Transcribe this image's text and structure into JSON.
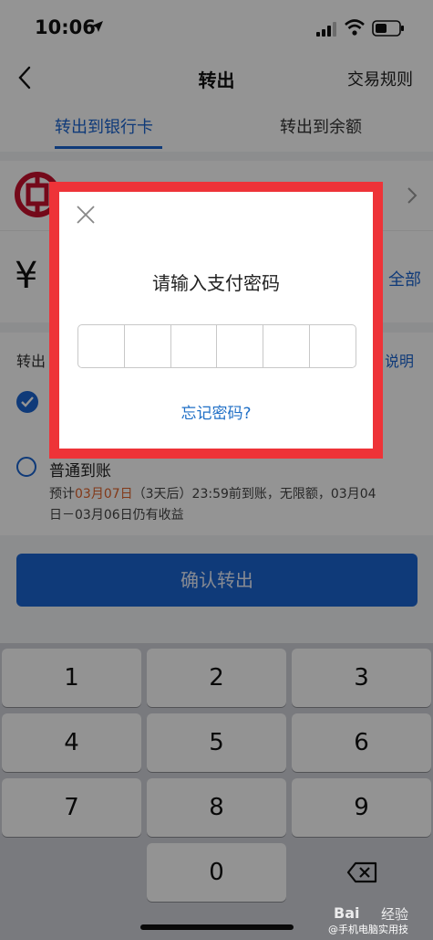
{
  "status_bar": {
    "time": "10:06"
  },
  "nav": {
    "title": "转出",
    "rules_label": "交易规则"
  },
  "tabs": [
    {
      "label": "转出到银行卡",
      "active": true
    },
    {
      "label": "转出到余额",
      "active": false
    }
  ],
  "amount": {
    "currency_symbol": "¥",
    "all_label": "全部"
  },
  "method": {
    "label_partial": "转出",
    "desc_link_partial": "说明",
    "option1": {
      "label_partial": "",
      "sub_partial": ""
    },
    "option2": {
      "label": "普通到账",
      "line1_prefix": "预计",
      "line1_date": "03月07日",
      "line1_suffix": "（3天后）23:59前到账，无限额，03月04",
      "line2": "日－03月06日仍有收益"
    }
  },
  "confirm_label": "确认转出",
  "keypad": {
    "keys": [
      "1",
      "2",
      "3",
      "4",
      "5",
      "6",
      "7",
      "8",
      "9",
      "",
      "0",
      "⌫"
    ]
  },
  "dialog": {
    "title": "请输入支付密码",
    "pin_length": 6,
    "forgot_label": "忘记密码?"
  },
  "watermark": {
    "brand": "Bai",
    "sub": "经验",
    "author": "@手机电脑实用技"
  },
  "colors": {
    "accent": "#1a64d0",
    "highlight": "#e0622a",
    "frame": "#ee3338"
  }
}
